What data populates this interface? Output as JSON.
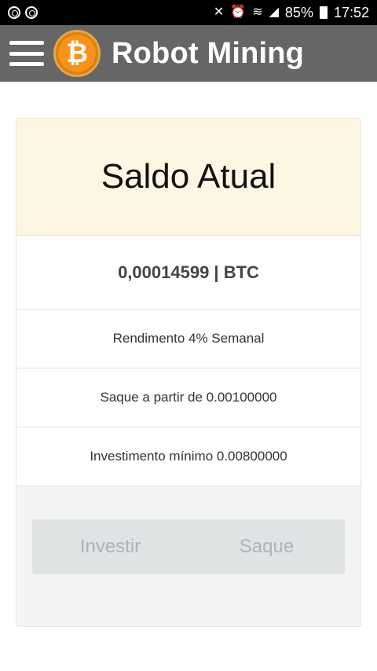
{
  "status_bar": {
    "battery": "85%",
    "time": "17:52"
  },
  "header": {
    "title": "Robot Mining",
    "logo_symbol": "₿"
  },
  "card": {
    "title": "Saldo Atual",
    "balance": "0,00014599 | BTC",
    "info_rows": [
      "Rendimento 4% Semanal",
      "Saque a partir de 0.00100000",
      "Investimento mínimo 0.00800000"
    ],
    "buttons": {
      "invest": "Investir",
      "withdraw": "Saque"
    }
  },
  "colors": {
    "header_bg": "#666666",
    "card_header_bg": "#fcf6e3",
    "bitcoin_orange": "#f7931a",
    "button_text": "#a9b4b8"
  }
}
